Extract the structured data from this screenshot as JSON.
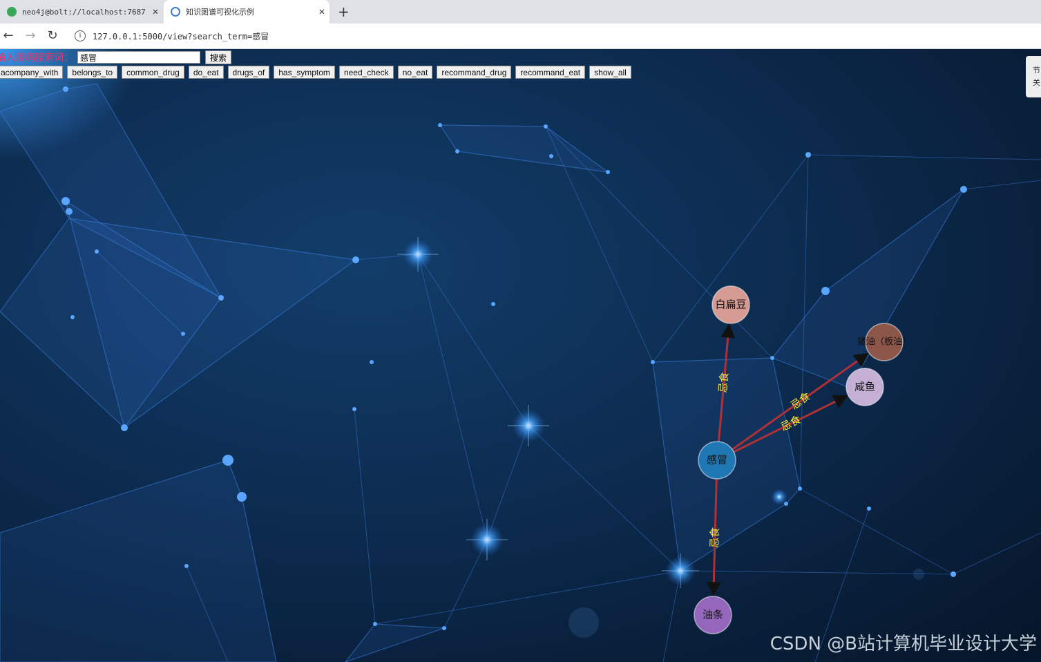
{
  "browser": {
    "tabs": [
      {
        "title": "neo4j@bolt://localhost:7687 -",
        "active": false
      },
      {
        "title": "知识图谱可视化示例",
        "active": true
      }
    ],
    "new_tab_glyph": "+",
    "close_glyph": "✕",
    "nav": {
      "back": "←",
      "forward": "→",
      "reload": "↻"
    },
    "url": "127.0.0.1:5000/view?search_term=感冒"
  },
  "search": {
    "label": "输入疾病搜索词：",
    "value": "感冒",
    "button": "搜索"
  },
  "relation_buttons": [
    "acompany_with",
    "belongs_to",
    "common_drug",
    "do_eat",
    "drugs_of",
    "has_symptom",
    "need_check",
    "no_eat",
    "recommand_drug",
    "recommand_eat",
    "show_all"
  ],
  "side_panel": {
    "text": "节关"
  },
  "graph": {
    "nodes": [
      {
        "id": "cold",
        "label": "感冒",
        "color": "#1f77b4"
      },
      {
        "id": "lentil",
        "label": "白扁豆",
        "color": "#d59a92"
      },
      {
        "id": "lard",
        "label": "猪油（板油）",
        "color": "#8c564b"
      },
      {
        "id": "saltfish",
        "label": "咸鱼",
        "color": "#c5b0d5"
      },
      {
        "id": "youtiao",
        "label": "油条",
        "color": "#9467bd"
      }
    ],
    "edges": [
      {
        "source": "cold",
        "target": "lentil",
        "label": "忌食"
      },
      {
        "source": "cold",
        "target": "lard",
        "label": "忌食"
      },
      {
        "source": "cold",
        "target": "saltfish",
        "label": "忌食"
      },
      {
        "source": "cold",
        "target": "youtiao",
        "label": "忌食"
      }
    ],
    "edge_color": "#b03038",
    "edge_label_color": "#ffeb3b"
  },
  "watermark": "CSDN @B站计算机毕业设计大学"
}
